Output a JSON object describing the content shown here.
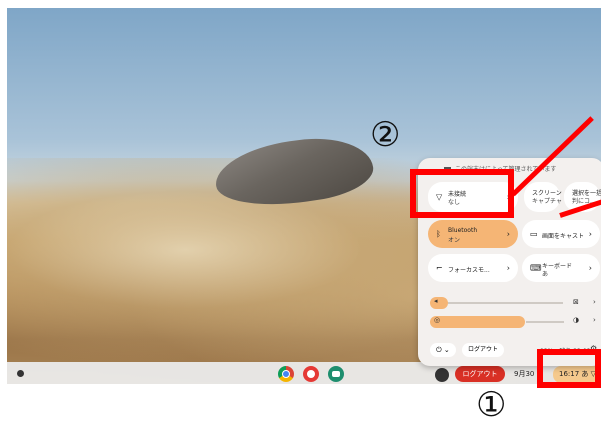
{
  "panel": {
    "notice": "この端末はによって管理されています",
    "tiles": [
      {
        "label": "未接続",
        "sub": "なし",
        "icon": "wifi-icon"
      },
      {
        "label": "スクリーン",
        "sub": "キャプチャ",
        "icon": ""
      },
      {
        "label": "選択を一括",
        "sub": "判にコ...",
        "icon": ""
      },
      {
        "label": "Bluetooth",
        "sub": "オン",
        "icon": "bluetooth-icon"
      },
      {
        "label": "画面をキャスト",
        "sub": "",
        "icon": "cast-icon"
      },
      {
        "label": "フォーカスモ...",
        "sub": "",
        "icon": "focus-icon"
      },
      {
        "label": "キーボード",
        "sub": "あ",
        "icon": "keyboard-icon"
      }
    ],
    "power_label": "⏻ ⌄",
    "logout_label": "ログアウト",
    "battery_text": "92% - 残り 22:02",
    "settings_icon": "⚙"
  },
  "shelf": {
    "logout_label": "ログアウト",
    "date": "9月30",
    "time": "16:17",
    "tray_suffix": "あ ▽ ▮"
  },
  "annotations": {
    "marker_1": "①",
    "marker_2": "②",
    "color": "#ff0000"
  }
}
